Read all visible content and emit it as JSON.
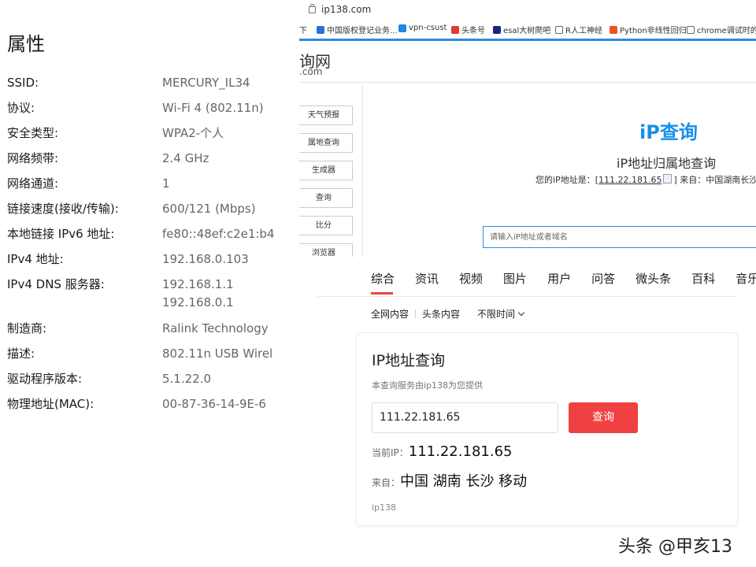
{
  "properties": {
    "title": "属性",
    "rows": [
      {
        "label": "SSID:",
        "value": "MERCURY_IL34"
      },
      {
        "label": "协议:",
        "value": "Wi-Fi 4 (802.11n)"
      },
      {
        "label": "安全类型:",
        "value": "WPA2-个人"
      },
      {
        "label": "网络频带:",
        "value": "2.4 GHz"
      },
      {
        "label": "网络通道:",
        "value": "1"
      },
      {
        "label": "链接速度(接收/传输):",
        "value": "600/121 (Mbps)"
      },
      {
        "label": "本地链接 IPv6 地址:",
        "value": "fe80::48ef:c2e1:b4"
      },
      {
        "label": "IPv4 地址:",
        "value": "192.168.0.103"
      },
      {
        "label": "IPv4 DNS 服务器:",
        "value": "192.168.1.1",
        "value2": "192.168.0.1"
      },
      {
        "label": "制造商:",
        "value": "Ralink Technology"
      },
      {
        "label": "描述:",
        "value": "802.11n USB Wirel"
      },
      {
        "label": "驱动程序版本:",
        "value": "5.1.22.0"
      },
      {
        "label": "物理地址(MAC):",
        "value": "00-87-36-14-9E-6"
      }
    ]
  },
  "browser": {
    "url": "ip138.com",
    "bookmarks": [
      {
        "label": "下",
        "icon_color": "#ffffff"
      },
      {
        "label": "中国版权登记业务...",
        "icon_color": "#2a6fd6"
      },
      {
        "label": "vpn-csust",
        "icon_color": "#1e88e5"
      },
      {
        "label": "头条号",
        "icon_color": "#e53935"
      },
      {
        "label": "esal大树爬吧",
        "icon_color": "#1a237e"
      },
      {
        "label": "R人工神经",
        "icon_color": "#666666"
      },
      {
        "label": "Python非线性回归",
        "icon_color": "#f4511e"
      },
      {
        "label": "chrome调试时的",
        "icon_color": "#666666"
      }
    ],
    "logo_big": "询网",
    "logo_small": ".com",
    "side_menu": [
      "天气预报",
      "属地查询",
      "生成器",
      "查询",
      "比分",
      "浏览器"
    ],
    "ipq_title": "iP查询",
    "ipq_subtitle": "iP地址归属地查询",
    "ipq_prefix": "您的iP地址是：[",
    "ipq_ip": "111.22.181.65",
    "ipq_suffix": "] 来自：中国湖南长沙",
    "ipq_placeholder": "请输入iP地址或者域名"
  },
  "search": {
    "tabs": [
      "综合",
      "资讯",
      "视频",
      "图片",
      "用户",
      "问答",
      "微头条",
      "百科",
      "音乐"
    ],
    "filter_all": "全网内容",
    "filter_toutiao": "头条内容",
    "filter_time": "不限时间",
    "card": {
      "title": "IP地址查询",
      "subtitle": "本查询服务由ip138为您提供",
      "input_value": "111.22.181.65",
      "button_label": "查询",
      "current_ip_label": "当前IP：",
      "current_ip_value": "111.22.181.65",
      "from_label": "来自：",
      "from_value": "中国 湖南 长沙 移动",
      "footer": "ip138"
    }
  },
  "watermark": "头条 @甲亥13"
}
